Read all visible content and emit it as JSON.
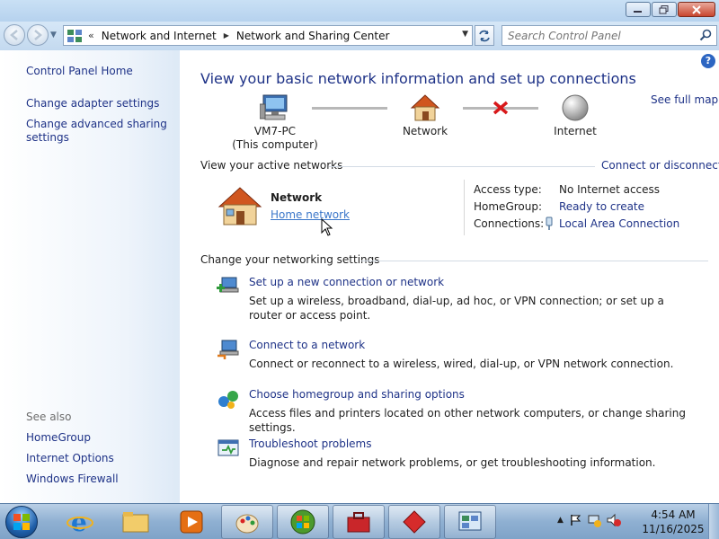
{
  "window": {
    "minimize_icon": "minimize-icon",
    "maximize_icon": "maximize-icon",
    "close_icon": "close-icon"
  },
  "nav": {
    "breadcrumbs": [
      "Network and Internet",
      "Network and Sharing Center"
    ],
    "chevron": "«",
    "search_placeholder": "Search Control Panel"
  },
  "left_pane": {
    "links": [
      "Control Panel Home",
      "Change adapter settings",
      "Change advanced sharing settings"
    ],
    "see_also_label": "See also",
    "see_also": [
      "HomeGroup",
      "Internet Options",
      "Windows Firewall"
    ]
  },
  "main": {
    "heading": "View your basic network information and set up connections",
    "see_full_map": "See full map",
    "map": {
      "computer_name": "VM7-PC",
      "computer_sub": "(This computer)",
      "network": "Network",
      "internet": "Internet"
    },
    "active_networks_label": "View your active networks",
    "connect_disconnect": "Connect or disconnect",
    "active_network": {
      "name": "Network",
      "type": "Home network",
      "access_type_label": "Access type:",
      "access_type_value": "No Internet access",
      "homegroup_label": "HomeGroup:",
      "homegroup_value": "Ready to create",
      "connections_label": "Connections:",
      "connections_value": "Local Area Connection"
    },
    "change_settings_label": "Change your networking settings",
    "tasks": [
      {
        "title": "Set up a new connection or network",
        "desc": "Set up a wireless, broadband, dial-up, ad hoc, or VPN connection; or set up a router or access point."
      },
      {
        "title": "Connect to a network",
        "desc": "Connect or reconnect to a wireless, wired, dial-up, or VPN network connection."
      },
      {
        "title": "Choose homegroup and sharing options",
        "desc": "Access files and printers located on other network computers, or change sharing settings."
      },
      {
        "title": "Troubleshoot problems",
        "desc": "Diagnose and repair network problems, or get troubleshooting information."
      }
    ]
  },
  "taskbar": {
    "time": "4:54 AM",
    "date": "11/16/2025"
  }
}
